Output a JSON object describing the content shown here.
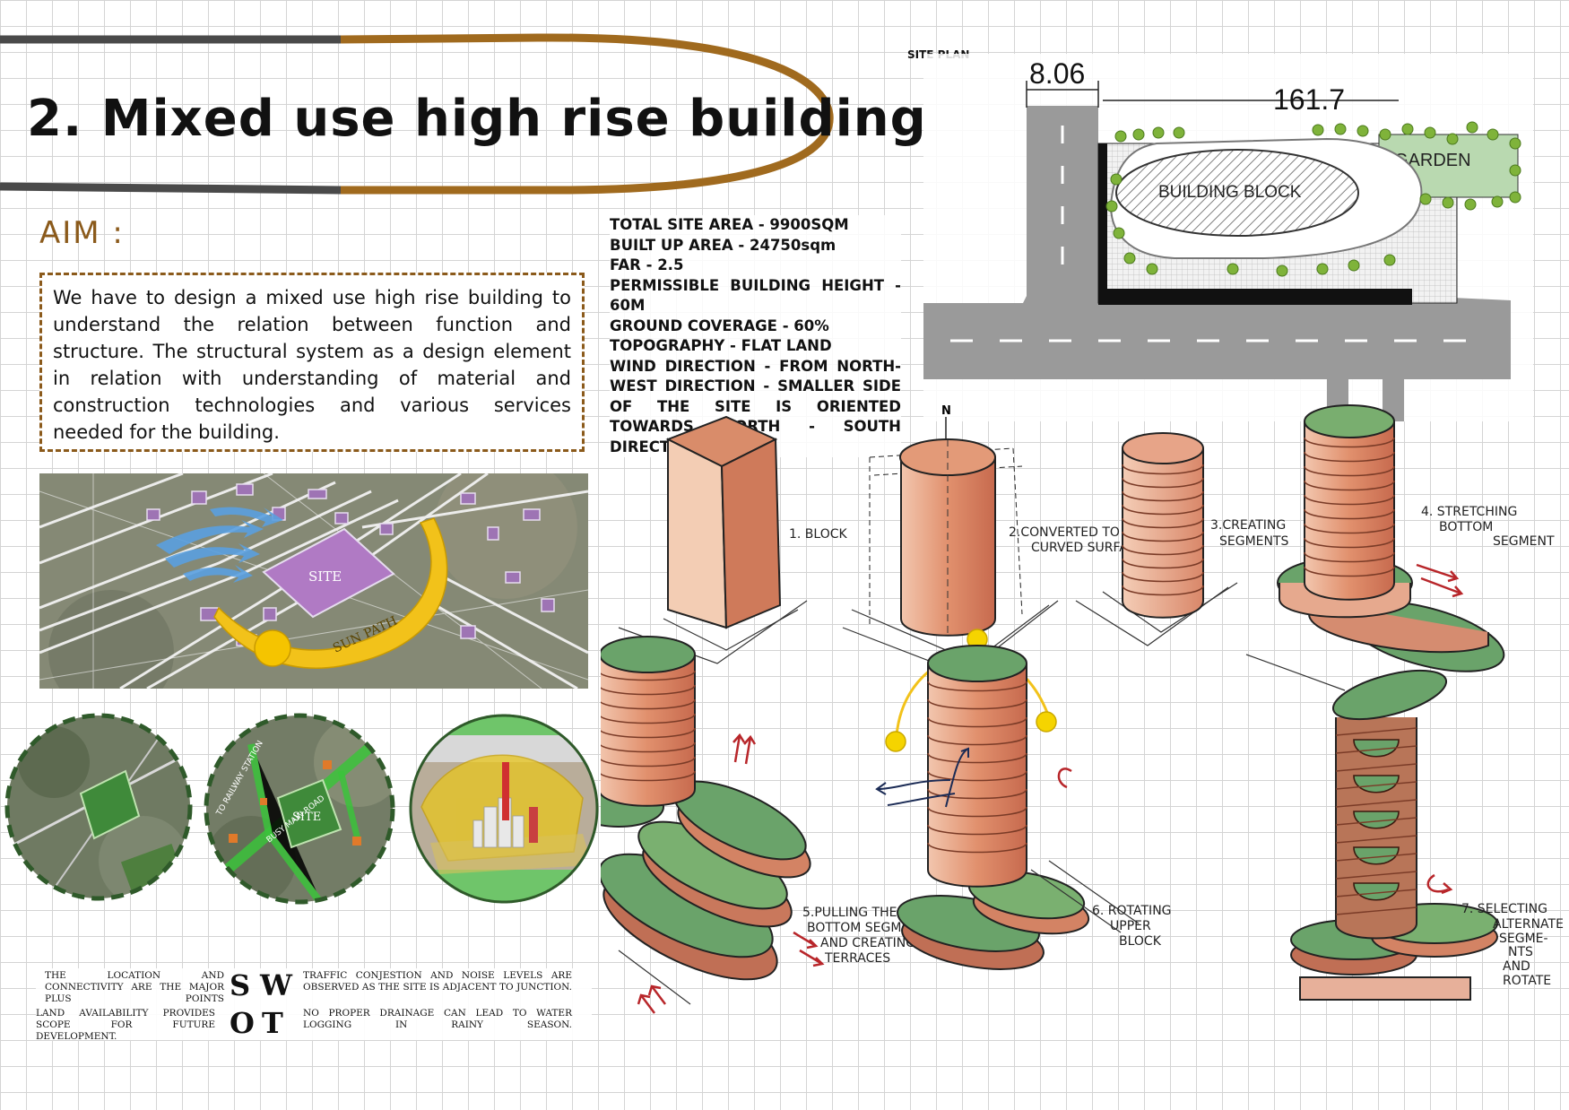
{
  "title": "2. Mixed use high rise building",
  "aim": {
    "heading": "AIM :",
    "text": "We have to design a mixed use high rise building to understand the relation between function and structure. The structural system as a design element in relation with understanding of material and construction technologies and various services needed for the building."
  },
  "site_data": [
    "TOTAL SITE AREA - 9900SQM",
    "BUILT UP AREA - 24750sqm",
    "FAR -  2.5",
    "PERMISSIBLE BUILDING HEIGHT - 60M",
    "GROUND COVERAGE - 60%",
    "TOPOGRAPHY - FLAT LAND",
    "WIND DIRECTION - FROM NORTH-WEST DIRECTION - SMALLER SIDE OF THE SITE IS ORIENTED TOWARDS NORTH - SOUTH DIRECTION"
  ],
  "site_plan": {
    "label": "SITE PLAN",
    "dim_width": "8.06",
    "dim_length": "161.7",
    "building_block": "BUILDING  BLOCK",
    "garden": "GARDEN"
  },
  "site_map": {
    "site_label": "SITE",
    "sun_path": "SUN  PATH"
  },
  "circle_maps": {
    "site_label": "SITE",
    "road_1": "BUSY MAIN ROAD",
    "road_2": "TO RAILWAY STATION"
  },
  "swot": {
    "s": "S",
    "w": "W",
    "o": "O",
    "t": "T",
    "strength": "THE LOCATION AND CONNECTIVITY ARE THE MAJOR PLUS POINTS",
    "weakness": "TRAFFIC CONJESTION AND NOISE LEVELS ARE OBSERVED AS THE SITE IS ADJACENT TO JUNCTION.",
    "opportunity": "LAND AVAILABILITY PROVIDES SCOPE FOR FUTURE DEVELOPMENT.",
    "threat": "NO PROPER DRAINAGE CAN LEAD TO WATER LOGGING IN RAINY SEASON."
  },
  "steps": {
    "north": "N",
    "s1": "1. BLOCK",
    "s2a": "2.CONVERTED TO",
    "s2b": "CURVED SURFACE",
    "s3a": "3.CREATING",
    "s3b": "SEGMENTS",
    "s4a": "4. STRETCHING",
    "s4b": "BOTTOM",
    "s4c": "SEGMENT",
    "s5a": "5.PULLING THE",
    "s5b": "BOTTOM SEGMENT",
    "s5c": "AND CREATING",
    "s5d": "TERRACES",
    "s6a": "6. ROTATING",
    "s6b": "UPPER",
    "s6c": "BLOCK",
    "s7a": "7. SELECTING",
    "s7b": "ALTERNATE",
    "s7c": "SEGME-",
    "s7d": "NTS",
    "s7e": "AND",
    "s7f": "ROTATE"
  },
  "colors": {
    "accent_brown": "#8B5A1B",
    "title_gold": "#A06A1E",
    "title_grey": "#4a4a4a",
    "terracotta": "#D9866A",
    "foliage": "#6FA86A",
    "sun_yellow": "#F2C21A",
    "site_purple": "#B07AC4"
  }
}
